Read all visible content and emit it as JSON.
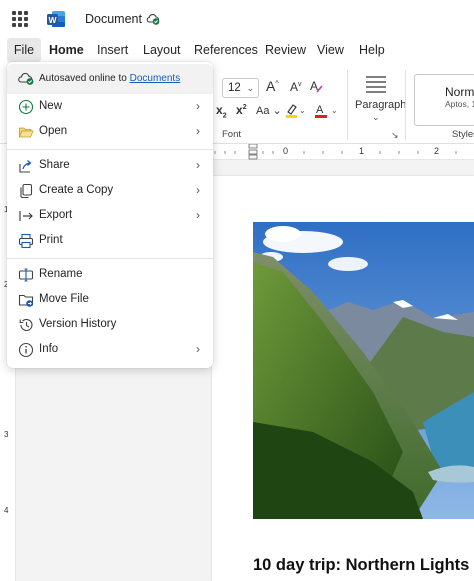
{
  "app": {
    "document_title": "Document",
    "logo_letter": "W"
  },
  "tabs": [
    "File",
    "Home",
    "Insert",
    "Layout",
    "References",
    "Review",
    "View",
    "Help"
  ],
  "ribbon": {
    "font_size": "12",
    "font_group_label": "Font",
    "paragraph_label": "Paragraph",
    "styles_label": "Styles",
    "styles_preview_name": "Norma",
    "styles_preview_font": "Aptos, 1"
  },
  "ruler": {
    "numbers": [
      "0",
      "1",
      "2"
    ]
  },
  "vertical_ruler": {
    "numbers": [
      "1",
      "2",
      "3",
      "4"
    ]
  },
  "file_menu": {
    "autosave_text": "Autosaved online to",
    "autosave_link": "Documents",
    "items": [
      {
        "label": "New",
        "icon": "new-icon",
        "submenu": true
      },
      {
        "label": "Open",
        "icon": "folder-open-icon",
        "submenu": true
      },
      {
        "label": "Share",
        "icon": "share-icon",
        "submenu": true
      },
      {
        "label": "Create a Copy",
        "icon": "copy-icon",
        "submenu": true
      },
      {
        "label": "Export",
        "icon": "export-icon",
        "submenu": true
      },
      {
        "label": "Print",
        "icon": "print-icon",
        "submenu": false
      },
      {
        "label": "Rename",
        "icon": "rename-icon",
        "submenu": false
      },
      {
        "label": "Move File",
        "icon": "move-file-icon",
        "submenu": false
      },
      {
        "label": "Version History",
        "icon": "history-icon",
        "submenu": false
      },
      {
        "label": "Info",
        "icon": "info-icon",
        "submenu": true
      }
    ]
  },
  "document": {
    "heading": "10 day trip: Northern Lights"
  },
  "colors": {
    "accent": "#185abd",
    "word_blue": "#2b579a",
    "highlight": "#ffd700",
    "font_color": "#e02020"
  }
}
